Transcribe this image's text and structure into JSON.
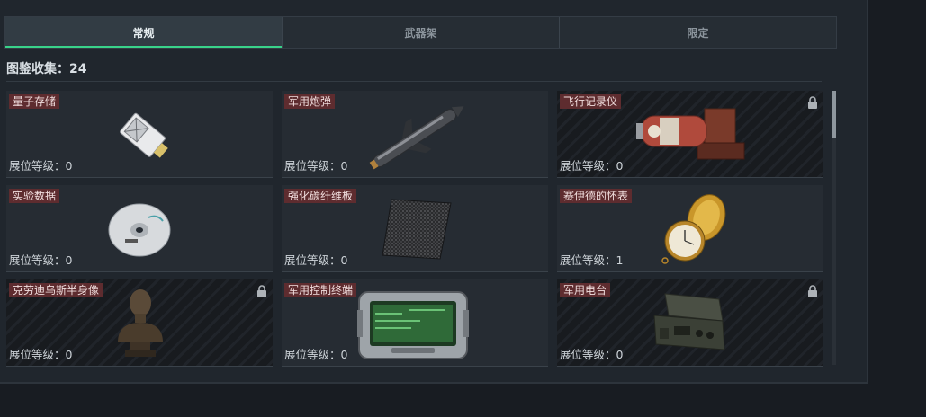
{
  "tabs": [
    {
      "label": "常规",
      "active": true
    },
    {
      "label": "武器架",
      "active": false
    },
    {
      "label": "限定",
      "active": false
    }
  ],
  "collection": {
    "label": "图鉴收集：24"
  },
  "level_prefix": "展位等级：",
  "items": [
    {
      "name": "量子存储",
      "level": "0",
      "locked": false,
      "icon": "usb-drive-icon"
    },
    {
      "name": "军用炮弹",
      "level": "0",
      "locked": false,
      "icon": "artillery-shell-icon"
    },
    {
      "name": "飞行记录仪",
      "level": "0",
      "locked": true,
      "icon": "flight-recorder-icon"
    },
    {
      "name": "实验数据",
      "level": "0",
      "locked": false,
      "icon": "data-disc-icon"
    },
    {
      "name": "强化碳纤维板",
      "level": "0",
      "locked": false,
      "icon": "carbon-plate-icon"
    },
    {
      "name": "赛伊德的怀表",
      "level": "1",
      "locked": false,
      "icon": "pocket-watch-icon"
    },
    {
      "name": "克劳迪乌斯半身像",
      "level": "0",
      "locked": true,
      "icon": "bust-statue-icon"
    },
    {
      "name": "军用控制终端",
      "level": "0",
      "locked": false,
      "icon": "control-terminal-icon"
    },
    {
      "name": "军用电台",
      "level": "0",
      "locked": true,
      "icon": "military-radio-icon"
    }
  ],
  "colors": {
    "accent": "#39d38a",
    "tag_bg": "#5e2c2f",
    "panel_bg": "#20262d"
  }
}
